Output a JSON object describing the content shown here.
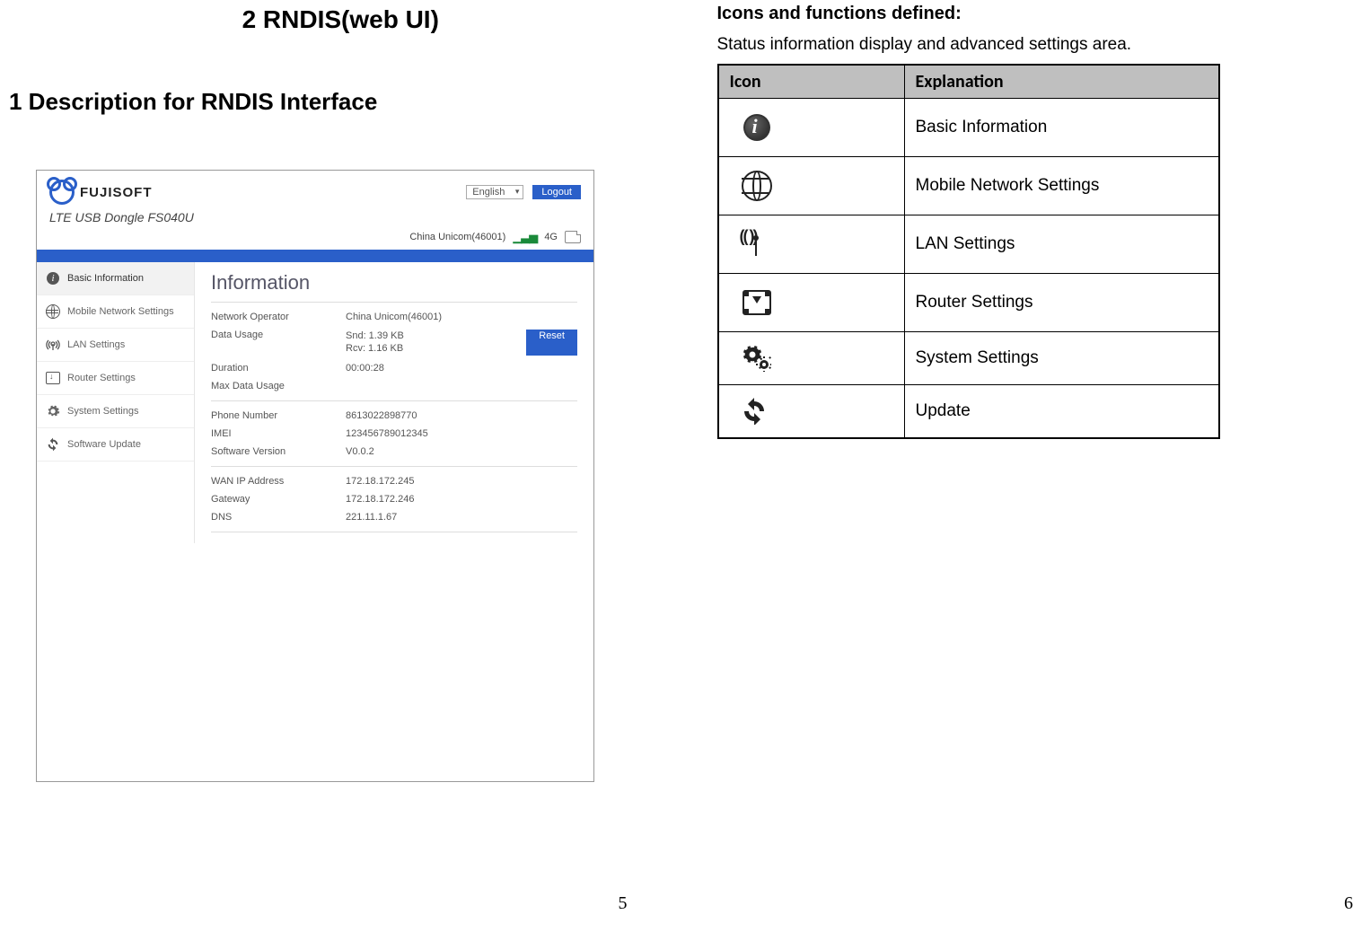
{
  "left": {
    "main_title": "2  RNDIS(web  UI)",
    "section_title": "1 Description for RNDIS Interface",
    "page_number": "5"
  },
  "right": {
    "heading": "Icons and functions defined:",
    "sub": "Status information display and advanced settings area.",
    "table_headers": {
      "icon": "Icon",
      "explanation": "Explanation"
    },
    "rows": [
      {
        "id": "info",
        "explanation": "Basic Information"
      },
      {
        "id": "globe",
        "explanation": "Mobile Network Settings"
      },
      {
        "id": "antenna",
        "explanation": "LAN Settings"
      },
      {
        "id": "router",
        "explanation": "Router Settings"
      },
      {
        "id": "gears",
        "explanation": "System Settings"
      },
      {
        "id": "refresh",
        "explanation": "Update"
      }
    ],
    "page_number": "6"
  },
  "screenshot": {
    "brand": "FUJISOFT",
    "model": "LTE USB Dongle FS040U",
    "language": "English",
    "logout": "Logout",
    "operator_status": "China Unicom(46001)",
    "network_type": "4G",
    "content_title": "Information",
    "reset_label": "Reset",
    "nav": [
      {
        "id": "info",
        "label": "Basic Information"
      },
      {
        "id": "globe",
        "label": "Mobile Network Settings"
      },
      {
        "id": "antenna",
        "label": "LAN Settings"
      },
      {
        "id": "router",
        "label": "Router Settings"
      },
      {
        "id": "gears",
        "label": "System Settings"
      },
      {
        "id": "refresh",
        "label": "Software Update"
      }
    ],
    "info": {
      "network_operator": {
        "label": "Network Operator",
        "value": "China Unicom(46001)"
      },
      "data_usage": {
        "label": "Data Usage",
        "snd": "Snd: 1.39 KB",
        "rcv": "Rcv: 1.16 KB"
      },
      "duration": {
        "label": "Duration",
        "value": "00:00:28"
      },
      "max_data_usage": {
        "label": "Max Data Usage",
        "value": ""
      },
      "phone_number": {
        "label": "Phone Number",
        "value": "8613022898770"
      },
      "imei": {
        "label": "IMEI",
        "value": "123456789012345"
      },
      "software_version": {
        "label": "Software Version",
        "value": "V0.0.2"
      },
      "wan_ip": {
        "label": "WAN IP Address",
        "value": "172.18.172.245"
      },
      "gateway": {
        "label": "Gateway",
        "value": "172.18.172.246"
      },
      "dns": {
        "label": "DNS",
        "value": "221.11.1.67"
      }
    }
  }
}
